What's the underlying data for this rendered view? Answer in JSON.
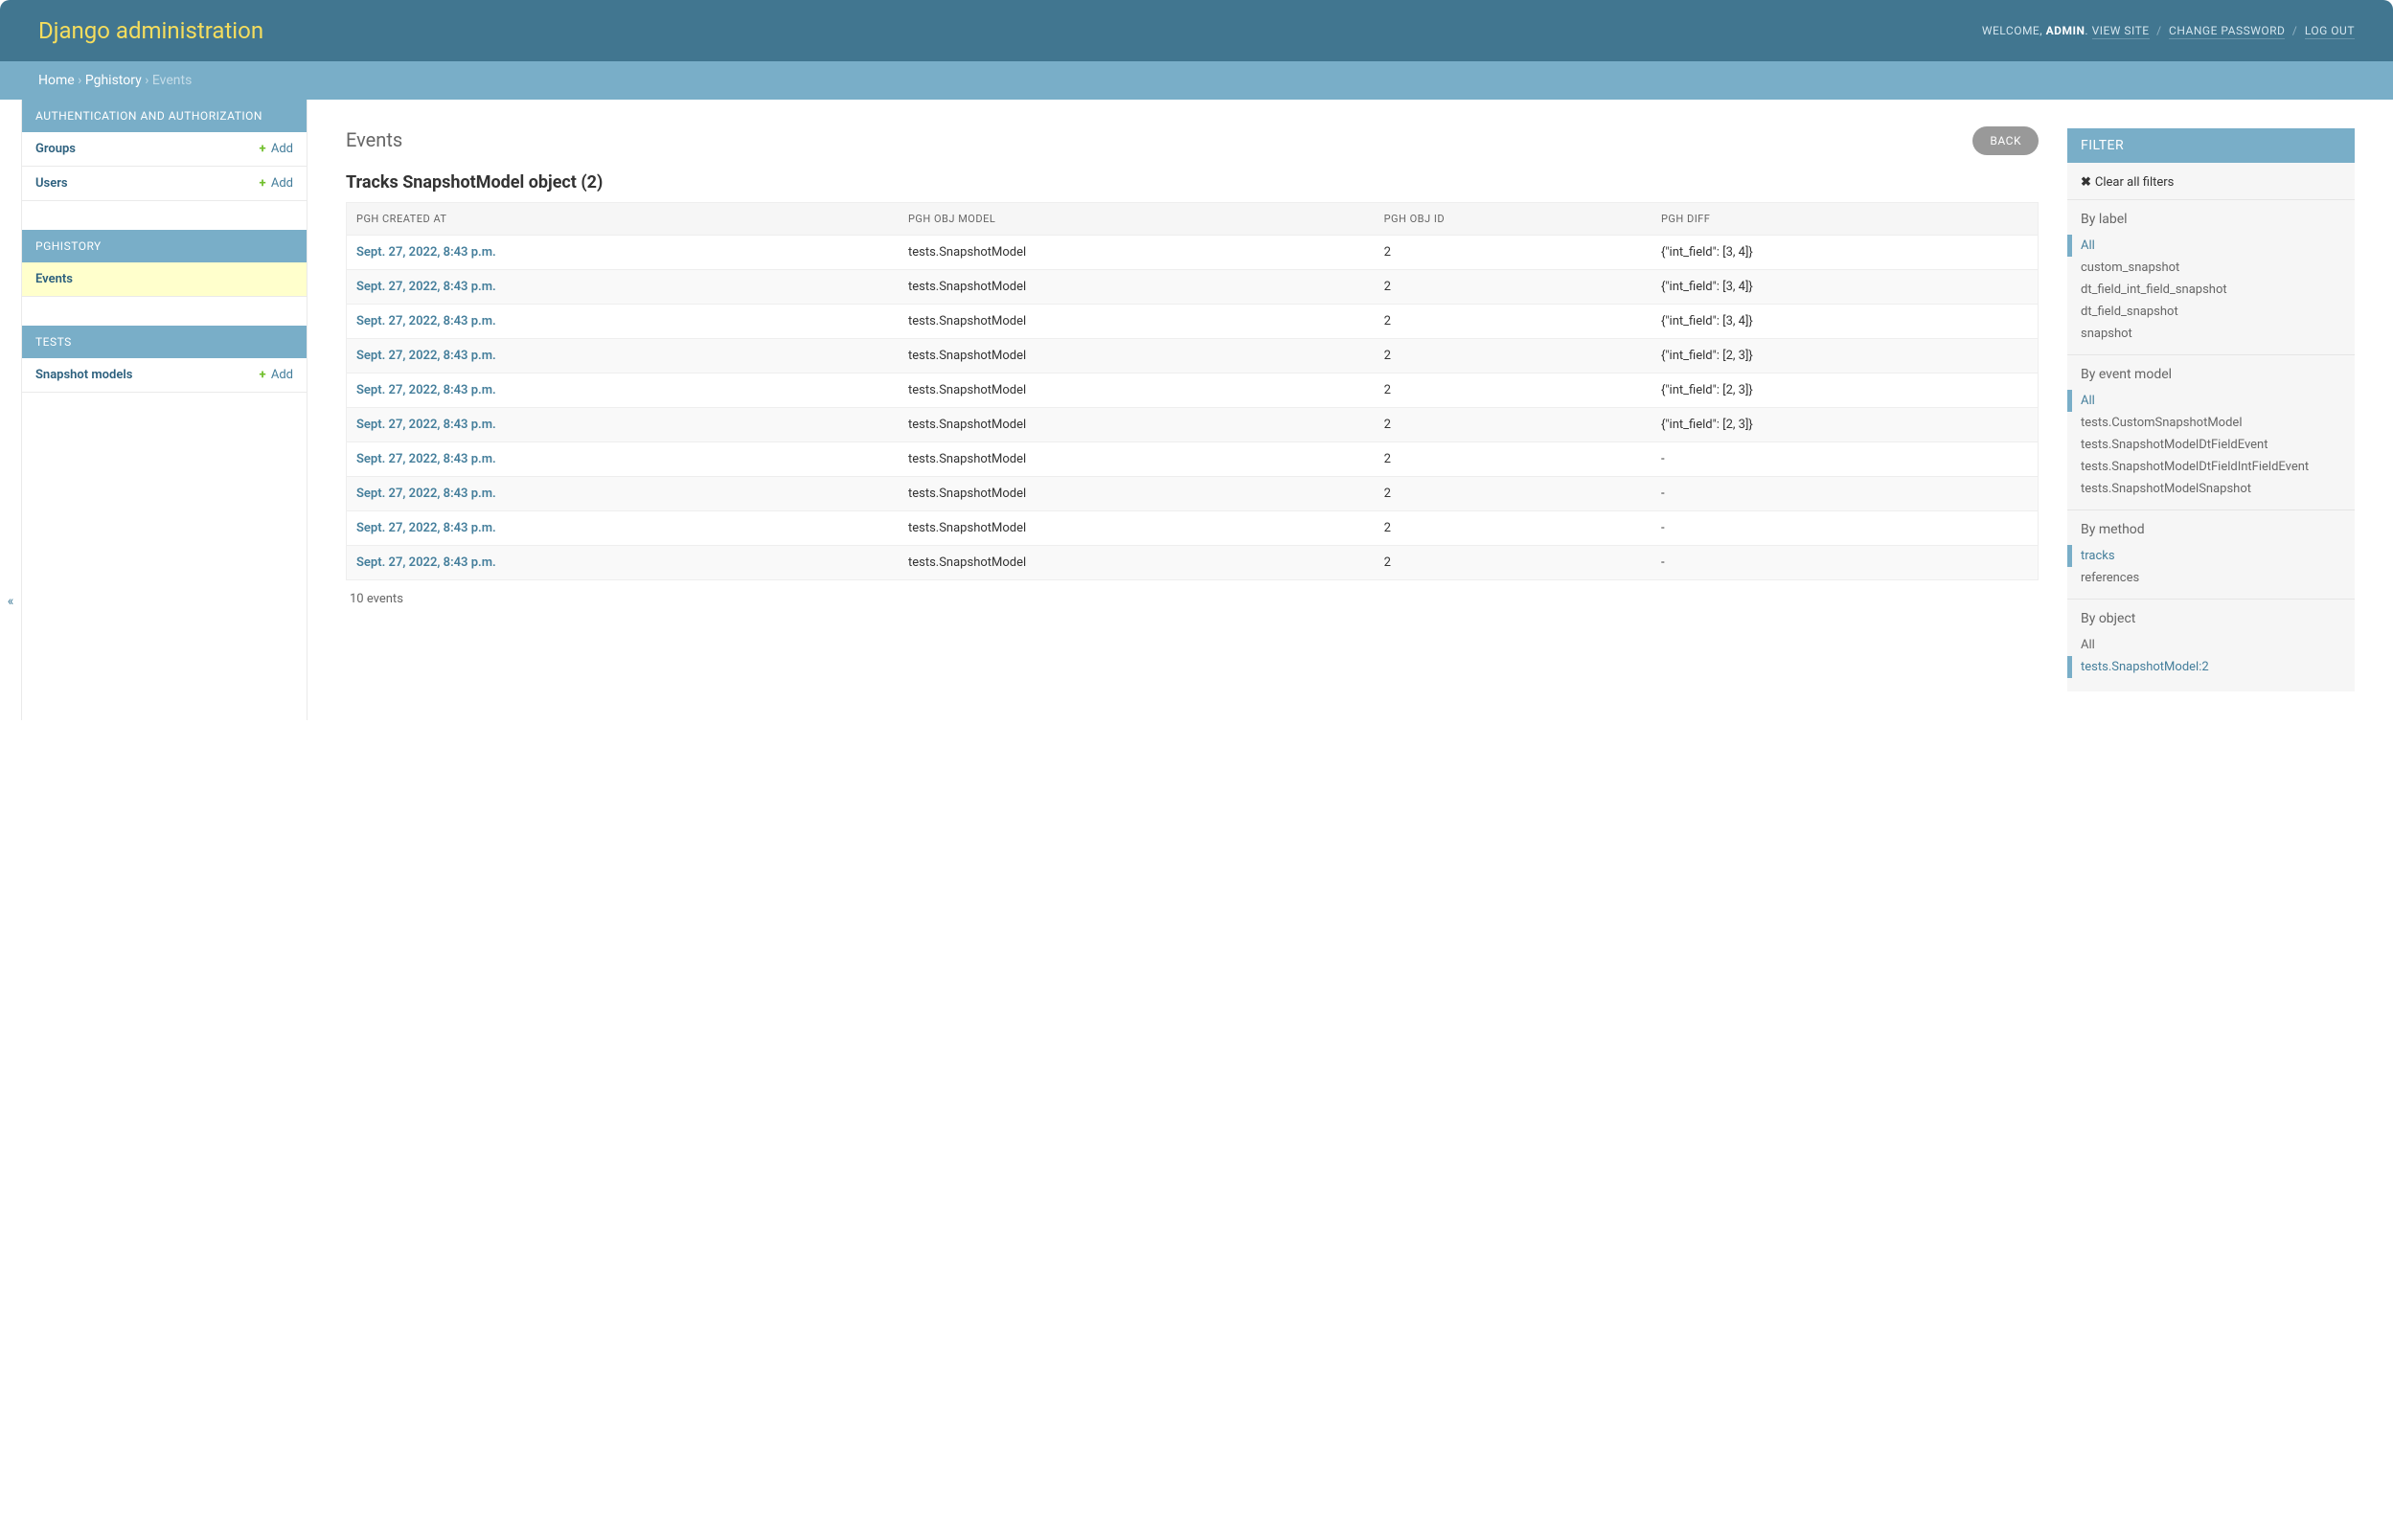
{
  "site_title": "Django administration",
  "user_tools": {
    "welcome": "WELCOME, ",
    "user": "ADMIN",
    "view_site": "VIEW SITE",
    "change_password": "CHANGE PASSWORD",
    "log_out": "LOG OUT"
  },
  "breadcrumbs": {
    "home": "Home",
    "app": "Pghistory",
    "current": "Events"
  },
  "toggle_glyph": "«",
  "sidebar": {
    "apps": [
      {
        "caption": "AUTHENTICATION AND AUTHORIZATION",
        "models": [
          {
            "label": "Groups",
            "add": "Add",
            "selected": false
          },
          {
            "label": "Users",
            "add": "Add",
            "selected": false
          }
        ]
      },
      {
        "caption": "PGHISTORY",
        "models": [
          {
            "label": "Events",
            "add": "",
            "selected": true
          }
        ]
      },
      {
        "caption": "TESTS",
        "models": [
          {
            "label": "Snapshot models",
            "add": "Add",
            "selected": false
          }
        ]
      }
    ]
  },
  "content": {
    "title": "Events",
    "back": "BACK",
    "subtitle": "Tracks SnapshotModel object (2)",
    "columns": [
      "PGH CREATED AT",
      "PGH OBJ MODEL",
      "PGH OBJ ID",
      "PGH DIFF"
    ],
    "rows": [
      {
        "created": "Sept. 27, 2022, 8:43 p.m.",
        "model": "tests.SnapshotModel",
        "obj_id": "2",
        "diff": "{\"int_field\": [3, 4]}"
      },
      {
        "created": "Sept. 27, 2022, 8:43 p.m.",
        "model": "tests.SnapshotModel",
        "obj_id": "2",
        "diff": "{\"int_field\": [3, 4]}"
      },
      {
        "created": "Sept. 27, 2022, 8:43 p.m.",
        "model": "tests.SnapshotModel",
        "obj_id": "2",
        "diff": "{\"int_field\": [3, 4]}"
      },
      {
        "created": "Sept. 27, 2022, 8:43 p.m.",
        "model": "tests.SnapshotModel",
        "obj_id": "2",
        "diff": "{\"int_field\": [2, 3]}"
      },
      {
        "created": "Sept. 27, 2022, 8:43 p.m.",
        "model": "tests.SnapshotModel",
        "obj_id": "2",
        "diff": "{\"int_field\": [2, 3]}"
      },
      {
        "created": "Sept. 27, 2022, 8:43 p.m.",
        "model": "tests.SnapshotModel",
        "obj_id": "2",
        "diff": "{\"int_field\": [2, 3]}"
      },
      {
        "created": "Sept. 27, 2022, 8:43 p.m.",
        "model": "tests.SnapshotModel",
        "obj_id": "2",
        "diff": "-"
      },
      {
        "created": "Sept. 27, 2022, 8:43 p.m.",
        "model": "tests.SnapshotModel",
        "obj_id": "2",
        "diff": "-"
      },
      {
        "created": "Sept. 27, 2022, 8:43 p.m.",
        "model": "tests.SnapshotModel",
        "obj_id": "2",
        "diff": "-"
      },
      {
        "created": "Sept. 27, 2022, 8:43 p.m.",
        "model": "tests.SnapshotModel",
        "obj_id": "2",
        "diff": "-"
      }
    ],
    "paginator": "10 events"
  },
  "filters": {
    "title": "FILTER",
    "clear": "Clear all filters",
    "clear_glyph": "✖",
    "groups": [
      {
        "title": "By label",
        "items": [
          {
            "label": "All",
            "selected": true
          },
          {
            "label": "custom_snapshot",
            "selected": false
          },
          {
            "label": "dt_field_int_field_snapshot",
            "selected": false
          },
          {
            "label": "dt_field_snapshot",
            "selected": false
          },
          {
            "label": "snapshot",
            "selected": false
          }
        ]
      },
      {
        "title": "By event model",
        "items": [
          {
            "label": "All",
            "selected": true
          },
          {
            "label": "tests.CustomSnapshotModel",
            "selected": false
          },
          {
            "label": "tests.SnapshotModelDtFieldEvent",
            "selected": false
          },
          {
            "label": "tests.SnapshotModelDtFieldIntFieldEvent",
            "selected": false
          },
          {
            "label": "tests.SnapshotModelSnapshot",
            "selected": false
          }
        ]
      },
      {
        "title": "By method",
        "items": [
          {
            "label": "tracks",
            "selected": true
          },
          {
            "label": "references",
            "selected": false
          }
        ]
      },
      {
        "title": "By object",
        "items": [
          {
            "label": "All",
            "selected": false
          },
          {
            "label": "tests.SnapshotModel:2",
            "selected": true
          }
        ]
      }
    ]
  }
}
